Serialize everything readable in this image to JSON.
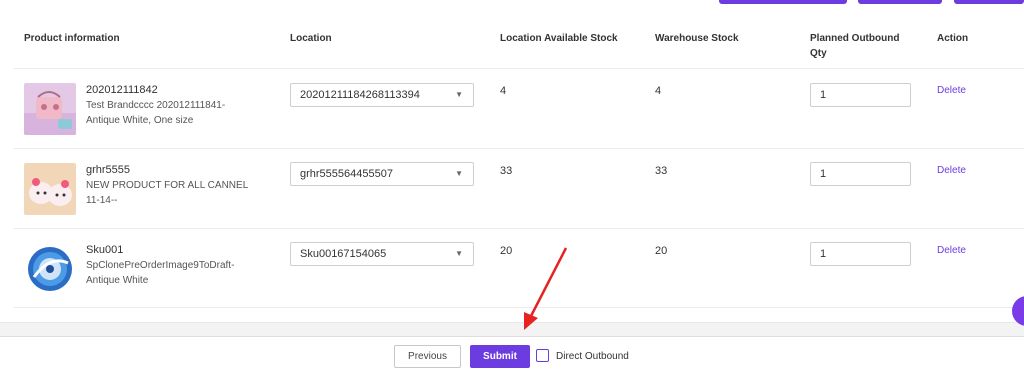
{
  "table": {
    "headers": {
      "product": "Product information",
      "location": "Location",
      "location_stock": "Location Available Stock",
      "warehouse_stock": "Warehouse Stock",
      "planned_qty_line1": "Planned Outbound",
      "planned_qty_line2": "Qty",
      "action": "Action"
    },
    "rows": [
      {
        "sku": "202012111842",
        "desc_line1": "Test Brandcccc 202012111841-",
        "desc_line2": "Antique White, One size",
        "location": "20201211184268113394",
        "location_stock": "4",
        "warehouse_stock": "4",
        "qty": "1",
        "action": "Delete",
        "thumb": "pink-bag-image"
      },
      {
        "sku": "grhr5555",
        "desc_line1": "NEW PRODUCT FOR ALL CANNEL",
        "desc_line2": "11-14--",
        "location": "grhr555564455507",
        "location_stock": "33",
        "warehouse_stock": "33",
        "qty": "1",
        "action": "Delete",
        "thumb": "hello-kitty-image"
      },
      {
        "sku": "Sku001",
        "desc_line1": "SpClonePreOrderImage9ToDraft-",
        "desc_line2": "Antique White",
        "location": "Sku00167154065",
        "location_stock": "20",
        "warehouse_stock": "20",
        "qty": "1",
        "action": "Delete",
        "thumb": "blue-swirl-image"
      }
    ]
  },
  "footer": {
    "previous": "Previous",
    "submit": "Submit",
    "direct_outbound": "Direct Outbound"
  },
  "colors": {
    "accent": "#6d3ce0",
    "annotation_arrow": "#e62222"
  },
  "icons": {
    "select_caret": "chevron-down-icon",
    "annotation": "red-arrow-icon"
  }
}
